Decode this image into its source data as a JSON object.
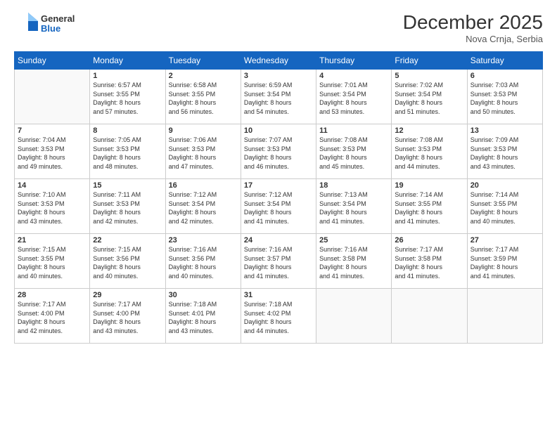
{
  "header": {
    "logo_line1": "General",
    "logo_line2": "Blue",
    "month_title": "December 2025",
    "location": "Nova Crnja, Serbia"
  },
  "days_of_week": [
    "Sunday",
    "Monday",
    "Tuesday",
    "Wednesday",
    "Thursday",
    "Friday",
    "Saturday"
  ],
  "weeks": [
    [
      {
        "num": "",
        "info": ""
      },
      {
        "num": "1",
        "info": "Sunrise: 6:57 AM\nSunset: 3:55 PM\nDaylight: 8 hours\nand 57 minutes."
      },
      {
        "num": "2",
        "info": "Sunrise: 6:58 AM\nSunset: 3:55 PM\nDaylight: 8 hours\nand 56 minutes."
      },
      {
        "num": "3",
        "info": "Sunrise: 6:59 AM\nSunset: 3:54 PM\nDaylight: 8 hours\nand 54 minutes."
      },
      {
        "num": "4",
        "info": "Sunrise: 7:01 AM\nSunset: 3:54 PM\nDaylight: 8 hours\nand 53 minutes."
      },
      {
        "num": "5",
        "info": "Sunrise: 7:02 AM\nSunset: 3:54 PM\nDaylight: 8 hours\nand 51 minutes."
      },
      {
        "num": "6",
        "info": "Sunrise: 7:03 AM\nSunset: 3:53 PM\nDaylight: 8 hours\nand 50 minutes."
      }
    ],
    [
      {
        "num": "7",
        "info": "Sunrise: 7:04 AM\nSunset: 3:53 PM\nDaylight: 8 hours\nand 49 minutes."
      },
      {
        "num": "8",
        "info": "Sunrise: 7:05 AM\nSunset: 3:53 PM\nDaylight: 8 hours\nand 48 minutes."
      },
      {
        "num": "9",
        "info": "Sunrise: 7:06 AM\nSunset: 3:53 PM\nDaylight: 8 hours\nand 47 minutes."
      },
      {
        "num": "10",
        "info": "Sunrise: 7:07 AM\nSunset: 3:53 PM\nDaylight: 8 hours\nand 46 minutes."
      },
      {
        "num": "11",
        "info": "Sunrise: 7:08 AM\nSunset: 3:53 PM\nDaylight: 8 hours\nand 45 minutes."
      },
      {
        "num": "12",
        "info": "Sunrise: 7:08 AM\nSunset: 3:53 PM\nDaylight: 8 hours\nand 44 minutes."
      },
      {
        "num": "13",
        "info": "Sunrise: 7:09 AM\nSunset: 3:53 PM\nDaylight: 8 hours\nand 43 minutes."
      }
    ],
    [
      {
        "num": "14",
        "info": "Sunrise: 7:10 AM\nSunset: 3:53 PM\nDaylight: 8 hours\nand 43 minutes."
      },
      {
        "num": "15",
        "info": "Sunrise: 7:11 AM\nSunset: 3:53 PM\nDaylight: 8 hours\nand 42 minutes."
      },
      {
        "num": "16",
        "info": "Sunrise: 7:12 AM\nSunset: 3:54 PM\nDaylight: 8 hours\nand 42 minutes."
      },
      {
        "num": "17",
        "info": "Sunrise: 7:12 AM\nSunset: 3:54 PM\nDaylight: 8 hours\nand 41 minutes."
      },
      {
        "num": "18",
        "info": "Sunrise: 7:13 AM\nSunset: 3:54 PM\nDaylight: 8 hours\nand 41 minutes."
      },
      {
        "num": "19",
        "info": "Sunrise: 7:14 AM\nSunset: 3:55 PM\nDaylight: 8 hours\nand 41 minutes."
      },
      {
        "num": "20",
        "info": "Sunrise: 7:14 AM\nSunset: 3:55 PM\nDaylight: 8 hours\nand 40 minutes."
      }
    ],
    [
      {
        "num": "21",
        "info": "Sunrise: 7:15 AM\nSunset: 3:55 PM\nDaylight: 8 hours\nand 40 minutes."
      },
      {
        "num": "22",
        "info": "Sunrise: 7:15 AM\nSunset: 3:56 PM\nDaylight: 8 hours\nand 40 minutes."
      },
      {
        "num": "23",
        "info": "Sunrise: 7:16 AM\nSunset: 3:56 PM\nDaylight: 8 hours\nand 40 minutes."
      },
      {
        "num": "24",
        "info": "Sunrise: 7:16 AM\nSunset: 3:57 PM\nDaylight: 8 hours\nand 41 minutes."
      },
      {
        "num": "25",
        "info": "Sunrise: 7:16 AM\nSunset: 3:58 PM\nDaylight: 8 hours\nand 41 minutes."
      },
      {
        "num": "26",
        "info": "Sunrise: 7:17 AM\nSunset: 3:58 PM\nDaylight: 8 hours\nand 41 minutes."
      },
      {
        "num": "27",
        "info": "Sunrise: 7:17 AM\nSunset: 3:59 PM\nDaylight: 8 hours\nand 41 minutes."
      }
    ],
    [
      {
        "num": "28",
        "info": "Sunrise: 7:17 AM\nSunset: 4:00 PM\nDaylight: 8 hours\nand 42 minutes."
      },
      {
        "num": "29",
        "info": "Sunrise: 7:17 AM\nSunset: 4:00 PM\nDaylight: 8 hours\nand 43 minutes."
      },
      {
        "num": "30",
        "info": "Sunrise: 7:18 AM\nSunset: 4:01 PM\nDaylight: 8 hours\nand 43 minutes."
      },
      {
        "num": "31",
        "info": "Sunrise: 7:18 AM\nSunset: 4:02 PM\nDaylight: 8 hours\nand 44 minutes."
      },
      {
        "num": "",
        "info": ""
      },
      {
        "num": "",
        "info": ""
      },
      {
        "num": "",
        "info": ""
      }
    ]
  ]
}
